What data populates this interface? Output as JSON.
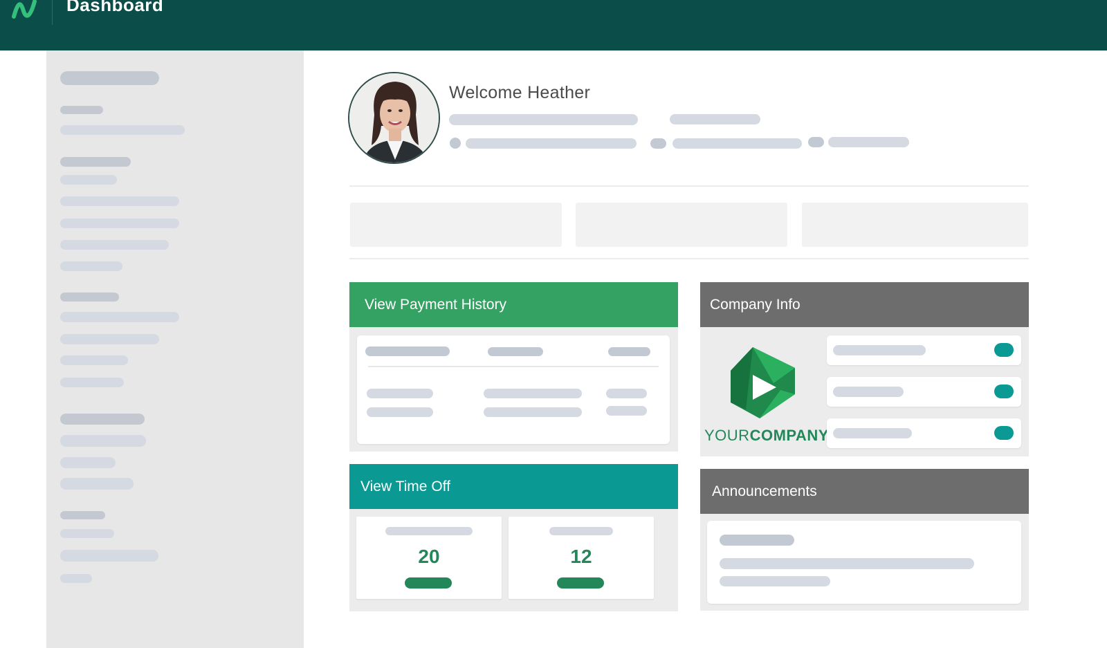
{
  "header": {
    "title": "Dashboard"
  },
  "profile": {
    "welcome": "Welcome Heather"
  },
  "payment": {
    "title": "View Payment History",
    "color": "#34a262"
  },
  "time_off": {
    "title": "View Time Off",
    "value_1": "20",
    "value_2": "12",
    "color": "#0b9993"
  },
  "company": {
    "title": "Company Info",
    "logo_text_1": "YOUR",
    "logo_text_2": "COMPANY",
    "color": "#6d6d6d"
  },
  "announcements": {
    "title": "Announcements",
    "color": "#6d6d6d"
  },
  "icons": {
    "logo": "app-logo-icon",
    "avatar": "user-avatar",
    "company": "play-triangle-logo"
  }
}
